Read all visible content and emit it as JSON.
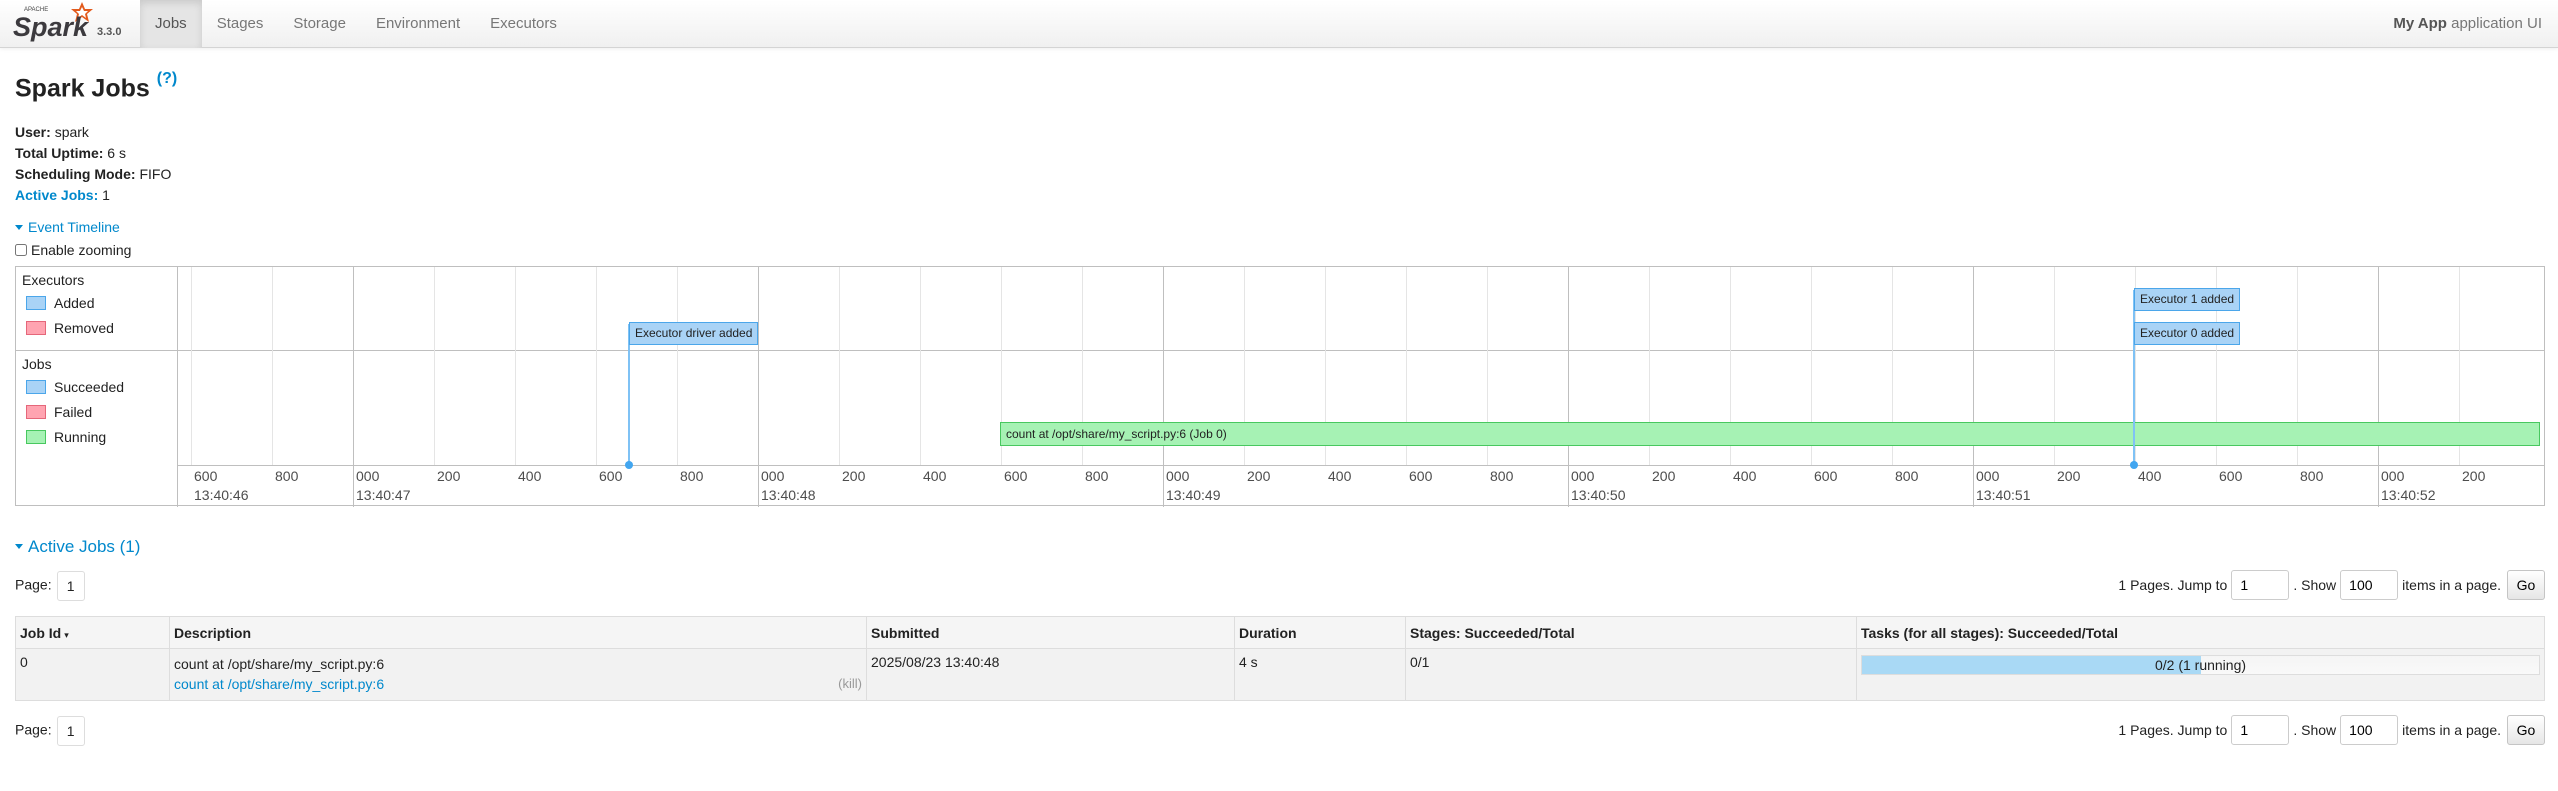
{
  "navbar": {
    "brand_text": "Spark",
    "version": "3.3.0",
    "tabs": [
      "Jobs",
      "Stages",
      "Storage",
      "Environment",
      "Executors"
    ],
    "active_tab": "Jobs",
    "app_name": "My App",
    "app_suffix": "application UI"
  },
  "header": {
    "title": "Spark Jobs",
    "help": "(?)"
  },
  "summary": {
    "user_label": "User:",
    "user_value": "spark",
    "uptime_label": "Total Uptime:",
    "uptime_value": "6 s",
    "mode_label": "Scheduling Mode:",
    "mode_value": "FIFO",
    "active_label": "Active Jobs:",
    "active_value": "1"
  },
  "timeline": {
    "toggle_label": "Event Timeline",
    "enable_zoom_label": "Enable zooming",
    "executors_title": "Executors",
    "executor_legend": [
      "Added",
      "Removed"
    ],
    "jobs_title": "Jobs",
    "job_legend": [
      "Succeeded",
      "Failed",
      "Running"
    ],
    "events": [
      "Executor driver added",
      "Executor 1 added",
      "Executor 0 added"
    ],
    "job_bar_label": "count at /opt/share/my_script.py:6 (Job 0)",
    "axis_minor": [
      "600",
      "800",
      "000",
      "200",
      "400",
      "600",
      "800",
      "000",
      "200",
      "400",
      "600",
      "800",
      "000",
      "200",
      "400",
      "600",
      "800",
      "000",
      "200",
      "400",
      "600",
      "800",
      "000",
      "200",
      "400",
      "600",
      "800",
      "000",
      "200"
    ],
    "axis_major": [
      "13:40:46",
      "13:40:47",
      "13:40:48",
      "13:40:49",
      "13:40:50",
      "13:40:51",
      "13:40:52"
    ]
  },
  "active_jobs": {
    "title": "Active Jobs (1)",
    "page_label": "Page:",
    "current_page": "1",
    "pages_text": "1 Pages. Jump to",
    "jump_value": "1",
    "show_label": ". Show",
    "show_value": "100",
    "items_label": "items in a page.",
    "go_label": "Go",
    "columns": [
      "Job Id",
      "Description",
      "Submitted",
      "Duration",
      "Stages: Succeeded/Total",
      "Tasks (for all stages): Succeeded/Total"
    ],
    "sort_indicator": "▾",
    "rows": [
      {
        "job_id": "0",
        "description": "count at /opt/share/my_script.py:6",
        "description_link": "count at /opt/share/my_script.py:6",
        "kill": "(kill)",
        "submitted": "2025/08/23 13:40:48",
        "duration": "4 s",
        "stages": "0/1",
        "tasks_text": "0/2 (1 running)",
        "tasks_progress": 0.5
      }
    ]
  },
  "colors": {
    "link": "#0088cc",
    "executor_added": "#a9d3f6",
    "removed": "#ffa4b1",
    "running": "#a6f2b4"
  }
}
